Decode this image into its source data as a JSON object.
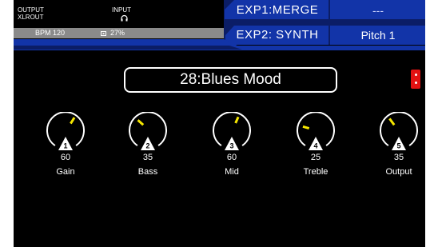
{
  "header": {
    "output_label": "OUTPUT",
    "output_value": "XLROUT",
    "input_label": "INPUT",
    "input_icon": "headphones-icon",
    "bpm": "BPM 120",
    "cpu_icon": "cpu-chip-icon",
    "cpu_usage": "27%",
    "exp1": "EXP1:MERGE",
    "exp1_value": "---",
    "exp2": "EXP2: SYNTH",
    "exp2_value": "Pitch 1",
    "accent_color": "#1234a8",
    "dark_accent_color": "#0b1d66"
  },
  "preset": {
    "name": "28:Blues Mood"
  },
  "tuner_icon": "tuner-indicator-icon",
  "knobs": [
    {
      "number": "1",
      "value": "60",
      "name": "Gain"
    },
    {
      "number": "2",
      "value": "35",
      "name": "Bass"
    },
    {
      "number": "3",
      "value": "60",
      "name": "Mid"
    },
    {
      "number": "4",
      "value": "25",
      "name": "Treble"
    },
    {
      "number": "5",
      "value": "35",
      "name": "Output"
    }
  ],
  "knob_pointer_color": "#f5e600"
}
